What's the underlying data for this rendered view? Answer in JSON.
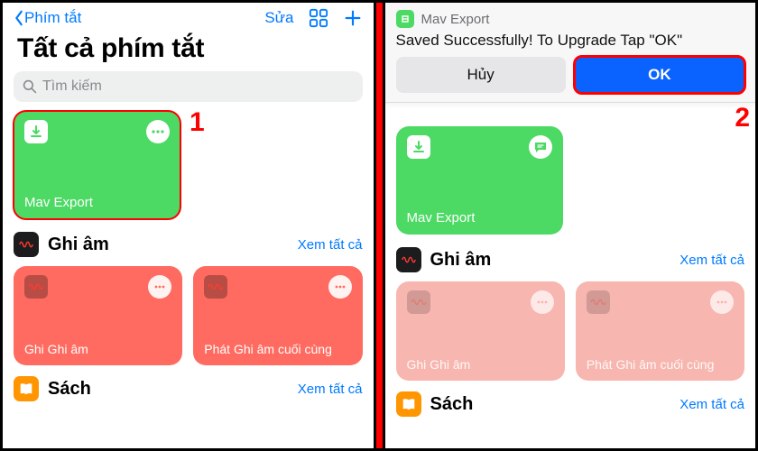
{
  "annotations": {
    "step1": "1",
    "step2": "2"
  },
  "left": {
    "nav_back": "Phím tắt",
    "nav_edit": "Sửa",
    "title": "Tất cả phím tắt",
    "search_placeholder": "Tìm kiếm",
    "tile_mav": "Mav Export",
    "sec_voice": "Ghi âm",
    "see_all": "Xem tất cả",
    "tile_v1": "Ghi Ghi âm",
    "tile_v2": "Phát Ghi âm cuối cùng",
    "sec_books": "Sách"
  },
  "right": {
    "banner_app": "Mav Export",
    "banner_msg": "Saved Successfully! To Upgrade Tap \"OK\"",
    "btn_cancel": "Hủy",
    "btn_ok": "OK",
    "tile_mav": "Mav Export",
    "sec_voice": "Ghi âm",
    "see_all": "Xem tất cả",
    "tile_v1": "Ghi Ghi âm",
    "tile_v2": "Phát Ghi âm cuối cùng",
    "sec_books": "Sách"
  }
}
